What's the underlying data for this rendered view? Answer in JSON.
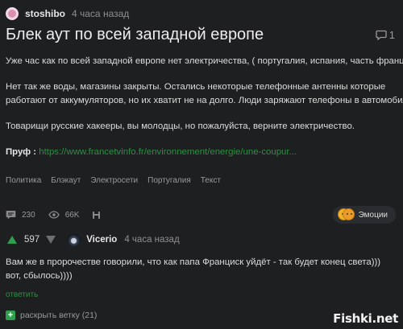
{
  "post": {
    "author": "stoshibo",
    "time": "4 часа назад",
    "title": "Блек аут по всей западной европе",
    "comments_count": "1",
    "paragraphs": [
      [
        "Уже час как по всей западной европе нет электричества, ( португалия, испания, часть франции.)"
      ],
      [
        "Нет так же воды, магазины закрыты. Остались некоторые телефонные антенны которые",
        "работают от аккумуляторов, но их хватит не на долго. Люди заряжают телефоны в автомобилях."
      ],
      [
        "Товарищи русские хакееры, вы молодцы, но пожалуйста, верните электричество."
      ]
    ],
    "proof_label": "Пруф :",
    "proof_link": "https://www.francetvinfo.fr/environnement/energie/une-coupur...",
    "tags": [
      "Политика",
      "Блэкаут",
      "Электросети",
      "Португалия",
      "Текст"
    ],
    "stats": {
      "comments": "230",
      "views": "66K"
    },
    "emotions_label": "Эмоции"
  },
  "comment": {
    "rating": "597",
    "author": "Vicerio",
    "time": "4 часа назад",
    "lines": [
      "Вам же в пророчестве говорили, что как папа Франциск уйдёт - так будет конец света)))",
      "вот, сбылось))))"
    ],
    "reply_label": "ответить",
    "expand_label": "раскрыть ветку (21)"
  },
  "watermark": "Fishki.net",
  "icons": {
    "avatar": "pink-avatar",
    "comments": "comment-icon",
    "views": "eye-icon",
    "save": "bookmark-icon",
    "emotions": "emoji-faces",
    "vote_up": "arrow-up-icon",
    "vote_down": "arrow-down-icon",
    "expand": "plus-icon"
  },
  "colors": {
    "background": "#1e1f21",
    "link": "#2f8f45",
    "accent": "#2f9e4f",
    "muted": "#9a9a9a"
  }
}
